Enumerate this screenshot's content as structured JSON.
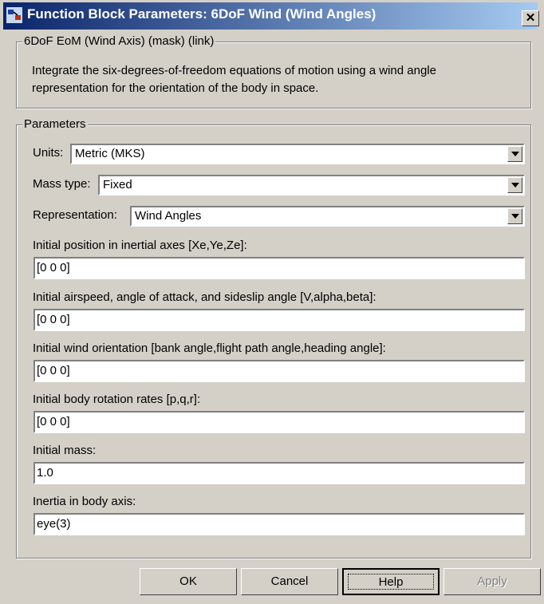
{
  "window": {
    "title": "Function Block Parameters: 6DoF Wind (Wind Angles)",
    "close_glyph": "✕"
  },
  "mask_group": {
    "legend": "6DoF EoM (Wind Axis) (mask) (link)",
    "description_line1": "Integrate the six-degrees-of-freedom equations of motion using a wind angle",
    "description_line2": "representation for the orientation of the body in space."
  },
  "parameters": {
    "legend": "Parameters",
    "units": {
      "label": "Units:",
      "value": "Metric (MKS)"
    },
    "mass_type": {
      "label": "Mass type:",
      "value": "Fixed"
    },
    "representation": {
      "label": "Representation:",
      "value": "Wind Angles"
    },
    "initial_position": {
      "label": "Initial position in inertial axes [Xe,Ye,Ze]:",
      "value": "[0 0 0]"
    },
    "initial_airspeed": {
      "label": "Initial airspeed, angle of attack, and sideslip angle [V,alpha,beta]:",
      "value": "[0 0 0]"
    },
    "initial_wind_orientation": {
      "label": "Initial wind orientation [bank angle,flight path angle,heading angle]:",
      "value": "[0 0 0]"
    },
    "initial_body_rates": {
      "label": "Initial body rotation rates [p,q,r]:",
      "value": "[0 0 0]"
    },
    "initial_mass": {
      "label": "Initial mass:",
      "value": "1.0"
    },
    "inertia": {
      "label": "Inertia in body axis:",
      "value": "eye(3)"
    }
  },
  "buttons": {
    "ok": "OK",
    "cancel": "Cancel",
    "help": "Help",
    "apply": "Apply"
  },
  "colors": {
    "titlebar_start": "#0a246a",
    "titlebar_end": "#a6caf0",
    "face": "#d4d0c8"
  },
  "icons": {
    "app": "simulink-block-icon",
    "close": "close-icon",
    "dropdown": "chevron-down-icon"
  }
}
